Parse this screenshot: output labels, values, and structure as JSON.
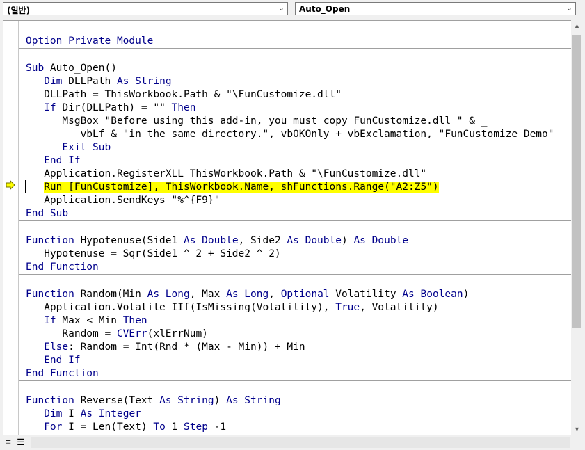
{
  "toolbar": {
    "object_combo": "(일반)",
    "procedure_combo": "Auto_Open"
  },
  "code": {
    "lines": [
      {
        "segments": [
          {
            "t": "Option Private Module",
            "k": true
          }
        ]
      },
      {
        "sep": true
      },
      {
        "segments": []
      },
      {
        "segments": [
          {
            "t": "Sub",
            "k": true
          },
          {
            "t": " Auto_Open()"
          }
        ]
      },
      {
        "segments": [
          {
            "t": "   "
          },
          {
            "t": "Dim",
            "k": true
          },
          {
            "t": " DLLPath "
          },
          {
            "t": "As String",
            "k": true
          }
        ]
      },
      {
        "segments": [
          {
            "t": "   DLLPath = ThisWorkbook.Path & \"\\FunCustomize.dll\""
          }
        ]
      },
      {
        "segments": [
          {
            "t": "   "
          },
          {
            "t": "If",
            "k": true
          },
          {
            "t": " Dir(DLLPath) = \"\" "
          },
          {
            "t": "Then",
            "k": true
          }
        ]
      },
      {
        "segments": [
          {
            "t": "      MsgBox \"Before using this add-in, you must copy FunCustomize.dll \" & _"
          }
        ]
      },
      {
        "segments": [
          {
            "t": "         vbLf & \"in the same directory.\", vbOKOnly + vbExclamation, \"FunCustomize Demo\""
          }
        ]
      },
      {
        "segments": [
          {
            "t": "      "
          },
          {
            "t": "Exit Sub",
            "k": true
          }
        ]
      },
      {
        "segments": [
          {
            "t": "   "
          },
          {
            "t": "End If",
            "k": true
          }
        ]
      },
      {
        "segments": [
          {
            "t": "   Application.RegisterXLL ThisWorkbook.Path & \"\\FunCustomize.dll\""
          }
        ]
      },
      {
        "segments": [
          {
            "t": "   "
          },
          {
            "t": "Run [FunCustomize], ThisWorkbook.Name, shFunctions.Range(\"A2:Z5\")",
            "h": true
          }
        ]
      },
      {
        "segments": [
          {
            "t": "   Application.SendKeys \"%^{F9}\""
          }
        ]
      },
      {
        "segments": [
          {
            "t": "End Sub",
            "k": true
          }
        ]
      },
      {
        "sep": true
      },
      {
        "segments": []
      },
      {
        "segments": [
          {
            "t": "Function",
            "k": true
          },
          {
            "t": " Hypotenuse(Side1 "
          },
          {
            "t": "As Double",
            "k": true
          },
          {
            "t": ", Side2 "
          },
          {
            "t": "As Double",
            "k": true
          },
          {
            "t": ") "
          },
          {
            "t": "As Double",
            "k": true
          }
        ]
      },
      {
        "segments": [
          {
            "t": "   Hypotenuse = Sqr(Side1 ^ 2 + Side2 ^ 2)"
          }
        ]
      },
      {
        "segments": [
          {
            "t": "End Function",
            "k": true
          }
        ]
      },
      {
        "sep": true
      },
      {
        "segments": []
      },
      {
        "segments": [
          {
            "t": "Function",
            "k": true
          },
          {
            "t": " Random(Min "
          },
          {
            "t": "As Long",
            "k": true
          },
          {
            "t": ", Max "
          },
          {
            "t": "As Long",
            "k": true
          },
          {
            "t": ", "
          },
          {
            "t": "Optional",
            "k": true
          },
          {
            "t": " Volatility "
          },
          {
            "t": "As Boolean",
            "k": true
          },
          {
            "t": ")"
          }
        ]
      },
      {
        "segments": [
          {
            "t": "   Application.Volatile IIf(IsMissing(Volatility), "
          },
          {
            "t": "True",
            "k": true
          },
          {
            "t": ", Volatility)"
          }
        ]
      },
      {
        "segments": [
          {
            "t": "   "
          },
          {
            "t": "If",
            "k": true
          },
          {
            "t": " Max < Min "
          },
          {
            "t": "Then",
            "k": true
          }
        ]
      },
      {
        "segments": [
          {
            "t": "      Random = "
          },
          {
            "t": "CVErr",
            "k": true
          },
          {
            "t": "(xlErrNum)"
          }
        ]
      },
      {
        "segments": [
          {
            "t": "   "
          },
          {
            "t": "Else",
            "k": true
          },
          {
            "t": ": Random = Int(Rnd * (Max - Min)) + Min"
          }
        ]
      },
      {
        "segments": [
          {
            "t": "   "
          },
          {
            "t": "End If",
            "k": true
          }
        ]
      },
      {
        "segments": [
          {
            "t": "End Function",
            "k": true
          }
        ]
      },
      {
        "sep": true
      },
      {
        "segments": []
      },
      {
        "segments": [
          {
            "t": "Function",
            "k": true
          },
          {
            "t": " Reverse(Text "
          },
          {
            "t": "As String",
            "k": true
          },
          {
            "t": ") "
          },
          {
            "t": "As String",
            "k": true
          }
        ]
      },
      {
        "segments": [
          {
            "t": "   "
          },
          {
            "t": "Dim",
            "k": true
          },
          {
            "t": " I "
          },
          {
            "t": "As Integer",
            "k": true
          }
        ]
      },
      {
        "segments": [
          {
            "t": "   "
          },
          {
            "t": "For",
            "k": true
          },
          {
            "t": " I = Len(Text) "
          },
          {
            "t": "To",
            "k": true
          },
          {
            "t": " 1 "
          },
          {
            "t": "Step",
            "k": true
          },
          {
            "t": " -1"
          }
        ]
      }
    ]
  },
  "icons": {
    "execution_pointer": "arrow-right-yellow",
    "scroll_up": "triangle-up",
    "scroll_down": "triangle-down",
    "procedure_view": "procedure-view",
    "full_module_view": "full-module-view"
  },
  "colors": {
    "keyword": "#00008b",
    "highlight": "#ffff00",
    "pointer": "#ffff00"
  }
}
